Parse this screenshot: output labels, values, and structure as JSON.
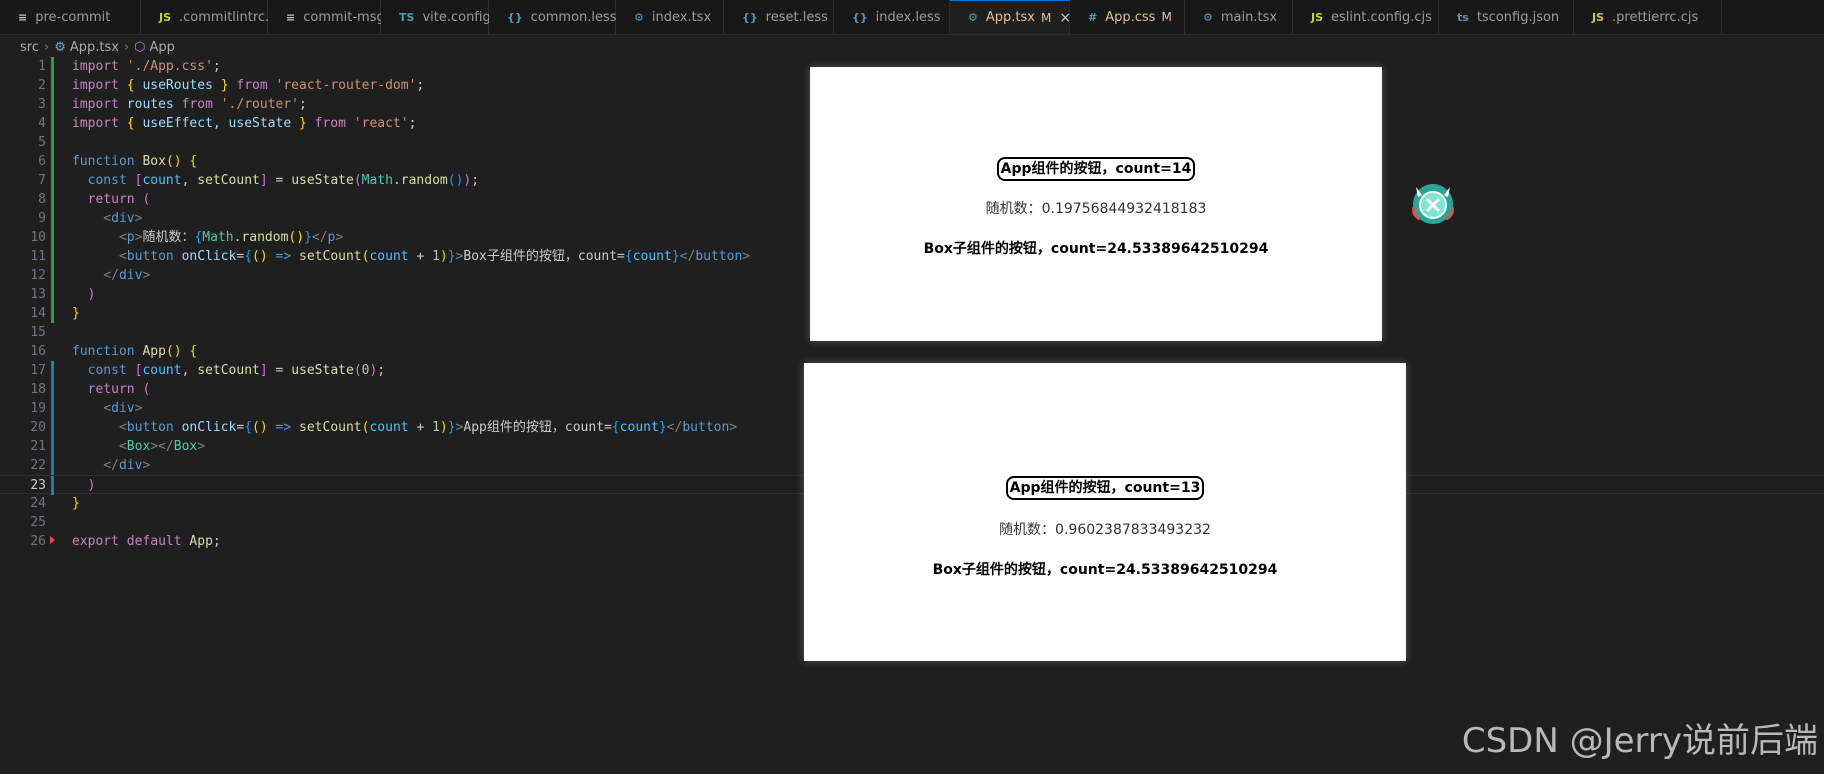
{
  "tabs": [
    {
      "icon": "≡",
      "icon_color": "#c5c5c5",
      "label": "pre-commit",
      "modified": "",
      "active": false,
      "label_color": "#9d9d9d"
    },
    {
      "icon": "JS",
      "icon_color": "#cbcb41",
      "label": ".commitlintrc.cjs",
      "modified": "",
      "active": false,
      "label_color": "#9d9d9d"
    },
    {
      "icon": "≡",
      "icon_color": "#c5c5c5",
      "label": "commit-msg",
      "modified": "",
      "active": false,
      "label_color": "#9d9d9d"
    },
    {
      "icon": "TS",
      "icon_color": "#519aba",
      "label": "vite.config.ts",
      "modified": "",
      "active": false,
      "label_color": "#9d9d9d"
    },
    {
      "icon": "{}",
      "icon_color": "#519aba",
      "label": "common.less",
      "modified": "",
      "active": false,
      "label_color": "#9d9d9d"
    },
    {
      "icon": "⚙",
      "icon_color": "#519aba",
      "label": "index.tsx",
      "modified": "",
      "active": false,
      "label_color": "#9d9d9d"
    },
    {
      "icon": "{}",
      "icon_color": "#519aba",
      "label": "reset.less",
      "modified": "",
      "active": false,
      "label_color": "#9d9d9d"
    },
    {
      "icon": "{}",
      "icon_color": "#519aba",
      "label": "index.less",
      "modified": "",
      "active": false,
      "label_color": "#9d9d9d"
    },
    {
      "icon": "⚙",
      "icon_color": "#519aba",
      "label": "App.tsx",
      "modified": "M",
      "active": true,
      "label_color": "#e2c08d"
    },
    {
      "icon": "#",
      "icon_color": "#519aba",
      "label": "App.css",
      "modified": "M",
      "active": false,
      "label_color": "#e2c08d"
    },
    {
      "icon": "⚙",
      "icon_color": "#519aba",
      "label": "main.tsx",
      "modified": "",
      "active": false,
      "label_color": "#9d9d9d"
    },
    {
      "icon": "JS",
      "icon_color": "#cbcb41",
      "label": "eslint.config.cjs",
      "modified": "",
      "active": false,
      "label_color": "#9d9d9d"
    },
    {
      "icon": "ts",
      "icon_color": "#519aba",
      "label": "tsconfig.json",
      "modified": "",
      "active": false,
      "label_color": "#9d9d9d"
    },
    {
      "icon": "JS",
      "icon_color": "#cbcb41",
      "label": ".prettierrc.cjs",
      "modified": "",
      "active": false,
      "label_color": "#9d9d9d"
    }
  ],
  "breadcrumb": {
    "folder": "src",
    "file": "App.tsx",
    "symbol": "App"
  },
  "code_lines": [
    {
      "n": "1",
      "gutter": "added",
      "tokens": [
        [
          "import ",
          "#c586c0"
        ],
        [
          "'./App.css'",
          "#ce9178"
        ],
        [
          ";",
          "#cccccc"
        ]
      ]
    },
    {
      "n": "2",
      "gutter": "added",
      "tokens": [
        [
          "import ",
          "#c586c0"
        ],
        [
          "{ ",
          "#ffd700"
        ],
        [
          "useRoutes ",
          "#9cdcfe"
        ],
        [
          "} ",
          "#ffd700"
        ],
        [
          "from ",
          "#c586c0"
        ],
        [
          "'react-router-dom'",
          "#ce9178"
        ],
        [
          ";",
          "#cccccc"
        ]
      ]
    },
    {
      "n": "3",
      "gutter": "added",
      "tokens": [
        [
          "import ",
          "#c586c0"
        ],
        [
          "routes ",
          "#9cdcfe"
        ],
        [
          "from ",
          "#c586c0"
        ],
        [
          "'./router'",
          "#ce9178"
        ],
        [
          ";",
          "#cccccc"
        ]
      ]
    },
    {
      "n": "4",
      "gutter": "added",
      "tokens": [
        [
          "import ",
          "#c586c0"
        ],
        [
          "{ ",
          "#ffd700"
        ],
        [
          "useEffect, useState ",
          "#9cdcfe"
        ],
        [
          "} ",
          "#ffd700"
        ],
        [
          "from ",
          "#c586c0"
        ],
        [
          "'react'",
          "#ce9178"
        ],
        [
          ";",
          "#cccccc"
        ]
      ]
    },
    {
      "n": "5",
      "gutter": "added",
      "tokens": []
    },
    {
      "n": "6",
      "gutter": "added",
      "tokens": [
        [
          "function ",
          "#569cd6"
        ],
        [
          "Box",
          "#dcdcaa"
        ],
        [
          "() ",
          "#ffd700"
        ],
        [
          "{",
          "#ffd700"
        ]
      ]
    },
    {
      "n": "7",
      "gutter": "added",
      "tokens": [
        [
          "  const ",
          "#569cd6"
        ],
        [
          "[",
          "#da70d6"
        ],
        [
          "count",
          "#4fc1ff"
        ],
        [
          ", ",
          "#cccccc"
        ],
        [
          "setCount",
          "#dcdcaa"
        ],
        [
          "] ",
          "#da70d6"
        ],
        [
          "= ",
          "#cccccc"
        ],
        [
          "useState",
          "#dcdcaa"
        ],
        [
          "(",
          "#da70d6"
        ],
        [
          "Math",
          "#4ec9b0"
        ],
        [
          ".",
          "#cccccc"
        ],
        [
          "random",
          "#dcdcaa"
        ],
        [
          "()",
          "#179fff"
        ],
        [
          ")",
          "#da70d6"
        ],
        [
          ";",
          "#cccccc"
        ]
      ]
    },
    {
      "n": "8",
      "gutter": "added",
      "tokens": [
        [
          "  return ",
          "#c586c0"
        ],
        [
          "(",
          "#da70d6"
        ]
      ]
    },
    {
      "n": "9",
      "gutter": "added",
      "tokens": [
        [
          "    <",
          "#808080"
        ],
        [
          "div",
          "#569cd6"
        ],
        [
          ">",
          "#808080"
        ]
      ]
    },
    {
      "n": "10",
      "gutter": "added",
      "tokens": [
        [
          "      <",
          "#808080"
        ],
        [
          "p",
          "#569cd6"
        ],
        [
          ">",
          "#808080"
        ],
        [
          "随机数：",
          "#cccccc"
        ],
        [
          "{",
          "#179fff"
        ],
        [
          "Math",
          "#4ec9b0"
        ],
        [
          ".",
          "#cccccc"
        ],
        [
          "random",
          "#dcdcaa"
        ],
        [
          "()",
          "#ffd700"
        ],
        [
          "}",
          "#179fff"
        ],
        [
          "</",
          "#808080"
        ],
        [
          "p",
          "#569cd6"
        ],
        [
          ">",
          "#808080"
        ]
      ]
    },
    {
      "n": "11",
      "gutter": "added",
      "tokens": [
        [
          "      <",
          "#808080"
        ],
        [
          "button ",
          "#569cd6"
        ],
        [
          "onClick",
          "#9cdcfe"
        ],
        [
          "=",
          "#cccccc"
        ],
        [
          "{",
          "#179fff"
        ],
        [
          "() ",
          "#ffd700"
        ],
        [
          "=> ",
          "#569cd6"
        ],
        [
          "setCount",
          "#dcdcaa"
        ],
        [
          "(",
          "#ffd700"
        ],
        [
          "count ",
          "#4fc1ff"
        ],
        [
          "+ ",
          "#cccccc"
        ],
        [
          "1",
          "#b5cea8"
        ],
        [
          ")",
          "#ffd700"
        ],
        [
          "}",
          "#179fff"
        ],
        [
          ">",
          "#808080"
        ],
        [
          "Box子组件的按钮",
          "#cccccc"
        ],
        [
          "，",
          "#cccccc"
        ],
        [
          "count=",
          "#cccccc"
        ],
        [
          "{",
          "#179fff"
        ],
        [
          "count",
          "#4fc1ff"
        ],
        [
          "}",
          "#179fff"
        ],
        [
          "</",
          "#808080"
        ],
        [
          "button",
          "#569cd6"
        ],
        [
          ">",
          "#808080"
        ]
      ]
    },
    {
      "n": "12",
      "gutter": "added",
      "tokens": [
        [
          "    </",
          "#808080"
        ],
        [
          "div",
          "#569cd6"
        ],
        [
          ">",
          "#808080"
        ]
      ]
    },
    {
      "n": "13",
      "gutter": "added",
      "tokens": [
        [
          "  )",
          "#da70d6"
        ]
      ]
    },
    {
      "n": "14",
      "gutter": "added",
      "tokens": [
        [
          "}",
          "#ffd700"
        ]
      ]
    },
    {
      "n": "15",
      "gutter": "",
      "tokens": []
    },
    {
      "n": "16",
      "gutter": "",
      "tokens": [
        [
          "function ",
          "#569cd6"
        ],
        [
          "App",
          "#dcdcaa"
        ],
        [
          "() ",
          "#ffd700"
        ],
        [
          "{",
          "#ffd700"
        ]
      ]
    },
    {
      "n": "17",
      "gutter": "mod",
      "tokens": [
        [
          "  const ",
          "#569cd6"
        ],
        [
          "[",
          "#da70d6"
        ],
        [
          "count",
          "#4fc1ff"
        ],
        [
          ", ",
          "#cccccc"
        ],
        [
          "setCount",
          "#dcdcaa"
        ],
        [
          "] ",
          "#da70d6"
        ],
        [
          "= ",
          "#cccccc"
        ],
        [
          "useState",
          "#dcdcaa"
        ],
        [
          "(",
          "#da70d6"
        ],
        [
          "0",
          "#b5cea8"
        ],
        [
          ")",
          "#da70d6"
        ],
        [
          ";",
          "#cccccc"
        ]
      ]
    },
    {
      "n": "18",
      "gutter": "mod",
      "tokens": [
        [
          "  return ",
          "#c586c0"
        ],
        [
          "(",
          "#da70d6"
        ]
      ]
    },
    {
      "n": "19",
      "gutter": "mod",
      "tokens": [
        [
          "    <",
          "#808080"
        ],
        [
          "div",
          "#569cd6"
        ],
        [
          ">",
          "#808080"
        ]
      ]
    },
    {
      "n": "20",
      "gutter": "mod",
      "tokens": [
        [
          "      <",
          "#808080"
        ],
        [
          "button ",
          "#569cd6"
        ],
        [
          "onClick",
          "#9cdcfe"
        ],
        [
          "=",
          "#cccccc"
        ],
        [
          "{",
          "#179fff"
        ],
        [
          "() ",
          "#ffd700"
        ],
        [
          "=> ",
          "#569cd6"
        ],
        [
          "setCount",
          "#dcdcaa"
        ],
        [
          "(",
          "#ffd700"
        ],
        [
          "count ",
          "#4fc1ff"
        ],
        [
          "+ ",
          "#cccccc"
        ],
        [
          "1",
          "#b5cea8"
        ],
        [
          ")",
          "#ffd700"
        ],
        [
          "}",
          "#179fff"
        ],
        [
          ">",
          "#808080"
        ],
        [
          "App组件的按钮",
          "#cccccc"
        ],
        [
          "，",
          "#cccccc"
        ],
        [
          "count=",
          "#cccccc"
        ],
        [
          "{",
          "#179fff"
        ],
        [
          "count",
          "#4fc1ff"
        ],
        [
          "}",
          "#179fff"
        ],
        [
          "</",
          "#808080"
        ],
        [
          "button",
          "#569cd6"
        ],
        [
          ">",
          "#808080"
        ]
      ]
    },
    {
      "n": "21",
      "gutter": "mod",
      "tokens": [
        [
          "      <",
          "#808080"
        ],
        [
          "Box",
          "#4ec9b0"
        ],
        [
          "></",
          "#808080"
        ],
        [
          "Box",
          "#4ec9b0"
        ],
        [
          ">",
          "#808080"
        ]
      ]
    },
    {
      "n": "22",
      "gutter": "mod",
      "tokens": [
        [
          "    </",
          "#808080"
        ],
        [
          "div",
          "#569cd6"
        ],
        [
          ">",
          "#808080"
        ]
      ]
    },
    {
      "n": "23",
      "gutter": "mod",
      "current": true,
      "tokens": [
        [
          "  )",
          "#da70d6"
        ]
      ]
    },
    {
      "n": "24",
      "gutter": "",
      "tokens": [
        [
          "}",
          "#ffd700"
        ]
      ]
    },
    {
      "n": "25",
      "gutter": "",
      "tokens": []
    },
    {
      "n": "26",
      "gutter": "del",
      "tokens": [
        [
          "export ",
          "#c586c0"
        ],
        [
          "default ",
          "#c586c0"
        ],
        [
          "App",
          "#dcdcaa"
        ],
        [
          ";",
          "#cccccc"
        ]
      ]
    }
  ],
  "preview_top": {
    "app_button": "App组件的按钮，count=14",
    "random_text": "随机数：0.19756844932418183",
    "box_button": "Box子组件的按钮，count=24.53389642510294"
  },
  "preview_bottom": {
    "app_button": "App组件的按钮，count=13",
    "random_text": "随机数：0.9602387833493232",
    "box_button": "Box子组件的按钮，count=24.53389642510294"
  },
  "watermark": "CSDN @Jerry说前后端"
}
